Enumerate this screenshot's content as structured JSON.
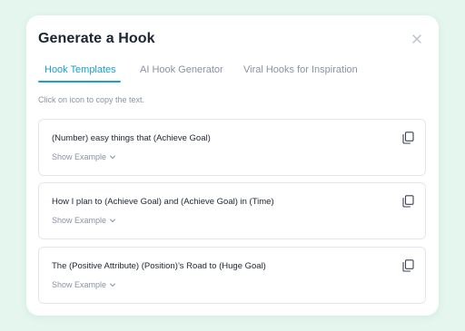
{
  "modal": {
    "title": "Generate a Hook"
  },
  "tabs": [
    {
      "label": "Hook Templates",
      "active": true
    },
    {
      "label": "AI Hook Generator",
      "active": false
    },
    {
      "label": "Viral Hooks for Inspiration",
      "active": false
    }
  ],
  "hint": "Click on icon to copy the text.",
  "templates": [
    {
      "text": "(Number) easy things that (Achieve Goal)",
      "show_example": "Show Example"
    },
    {
      "text": "How I plan to (Achieve Goal) and (Achieve Goal) in (Time)",
      "show_example": "Show Example"
    },
    {
      "text": "The (Positive Attribute) (Position)’s Road to (Huge Goal)",
      "show_example": "Show Example"
    }
  ],
  "colors": {
    "accent": "#1aa0cf",
    "background": "#e4f6ee",
    "text": "#1d2433",
    "muted": "#8a93a3",
    "border": "#e3e7ec"
  },
  "icons": {
    "close": "close-icon",
    "copy": "copy-icon",
    "chevron": "chevron-down-icon"
  }
}
